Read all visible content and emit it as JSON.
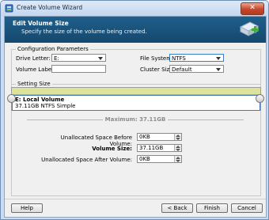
{
  "window": {
    "title": "Create Volume Wizard",
    "close_glyph": "✕"
  },
  "header": {
    "title": "Edit Volume Size",
    "subtitle": "Specify the size of the volume being created."
  },
  "config": {
    "group_label": "Configuration Parameters",
    "drive_letter_label": "Drive Letter:",
    "drive_letter_value": "E:",
    "file_system_label": "File System:",
    "file_system_value": "NTFS",
    "volume_label_label": "Volume Label:",
    "volume_label_value": "",
    "cluster_size_label": "Cluster Size:",
    "cluster_size_value": "Default"
  },
  "setting": {
    "group_label": "Setting Size",
    "volume_name": "E: Local Volume",
    "volume_info": "37.11GB NTFS Simple",
    "maximum_text": "Maximum: 37.11GB",
    "before_label": "Unallocated Space Before Volume:",
    "before_value": "0KB",
    "size_label": "Volume Size:",
    "size_value": "37.11GB",
    "after_label": "Unallocated Space After Volume:",
    "after_value": "0KB"
  },
  "footer": {
    "help": "Help",
    "back": "< Back",
    "finish": "Finish",
    "cancel": "Cancel"
  },
  "colors": {
    "header_bg": "#1a5580",
    "disk_bar": "#dde39a",
    "selection_border": "#4a7ab6"
  },
  "icons": [
    "wizard-app-icon",
    "close-icon",
    "volume-add-icon",
    "dropdown-arrow-icon",
    "spinner-arrows-icon"
  ]
}
